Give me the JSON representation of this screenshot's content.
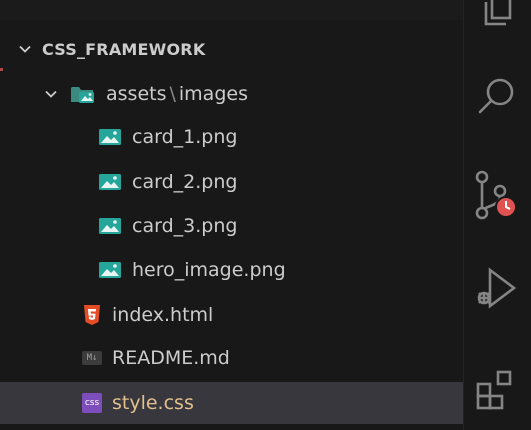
{
  "explorer": {
    "section_title": "CSS_FRAMEWORK",
    "folder": {
      "name_part1": "assets",
      "separator": "\\",
      "name_part2": "images",
      "files": [
        "card_1.png",
        "card_2.png",
        "card_3.png",
        "hero_image.png"
      ]
    },
    "root_files": [
      {
        "name": "index.html",
        "icon": "html5-icon"
      },
      {
        "name": "README.md",
        "icon": "markdown-icon",
        "badge": "M↓"
      },
      {
        "name": "style.css",
        "icon": "css-icon",
        "badge": "css",
        "selected": true
      }
    ]
  },
  "activity_bar": {
    "icons": [
      "explorer-icon",
      "search-icon",
      "source-control-icon",
      "run-debug-icon",
      "extensions-icon"
    ]
  },
  "colors": {
    "background": "#181818",
    "selected_row": "#37373d",
    "text": "#cccccc",
    "css_file_text": "#e2c08d",
    "image_icon": "#26a69a",
    "html_icon": "#e44d26",
    "css_icon": "#7c4dbb",
    "badge_red": "#e05252"
  }
}
